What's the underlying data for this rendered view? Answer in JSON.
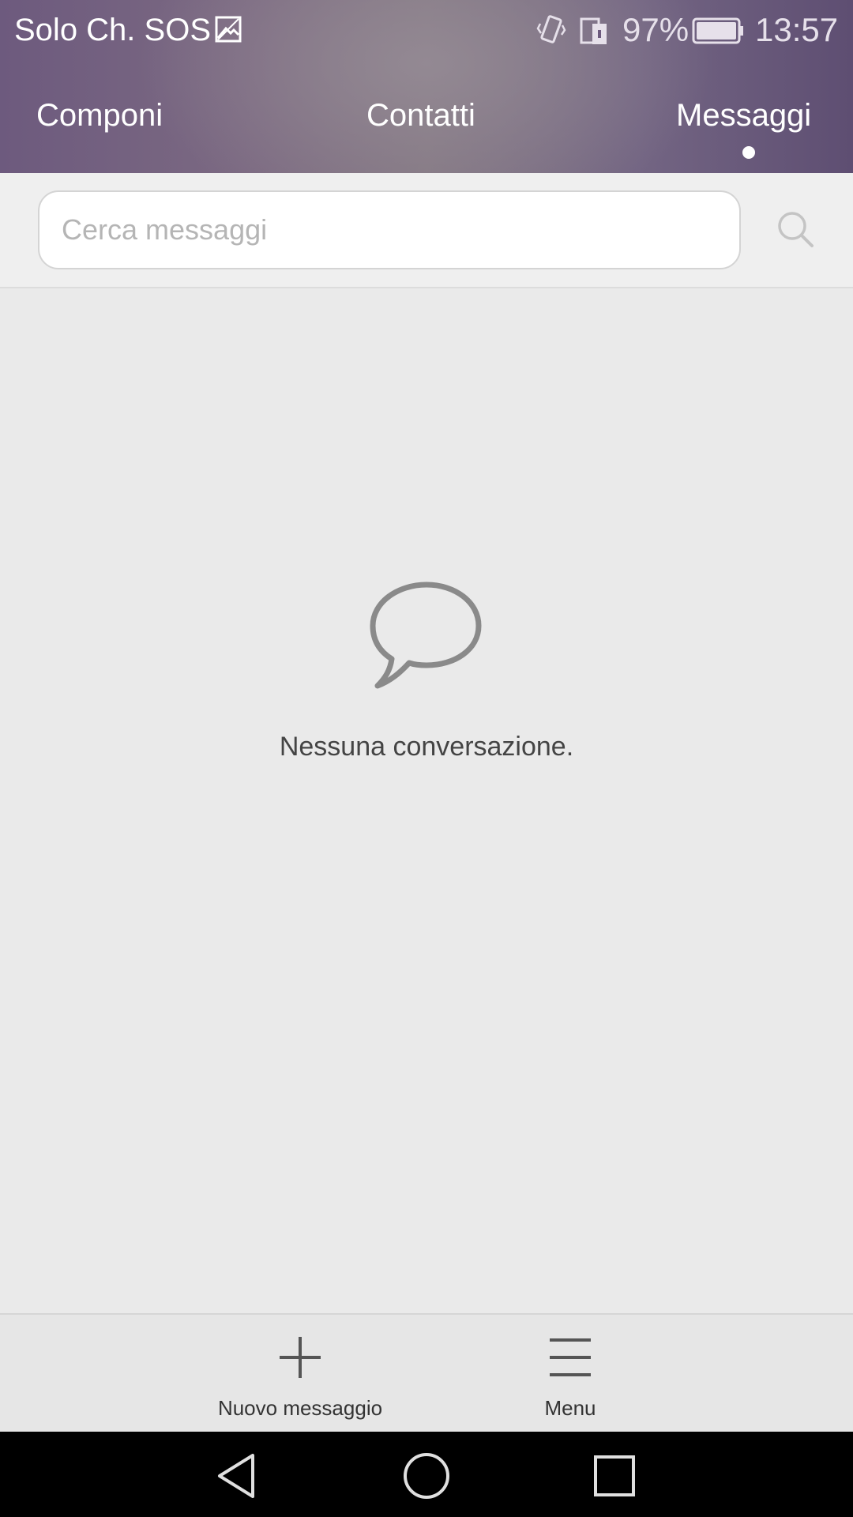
{
  "status_bar": {
    "carrier": "Solo Ch. SOS",
    "battery_percent": "97%",
    "time": "13:57",
    "icons": [
      "image-icon",
      "vibrate-icon",
      "sim-icon",
      "battery-icon"
    ]
  },
  "tabs": [
    {
      "label": "Componi",
      "selected": false
    },
    {
      "label": "Contatti",
      "selected": false
    },
    {
      "label": "Messaggi",
      "selected": true
    }
  ],
  "search": {
    "placeholder": "Cerca messaggi",
    "value": ""
  },
  "empty_state": {
    "icon": "speech-bubble-icon",
    "text": "Nessuna conversazione."
  },
  "bottom_actions": {
    "new_message_label": "Nuovo messaggio",
    "menu_label": "Menu"
  },
  "nav_bar": {
    "icons": [
      "back-icon",
      "home-icon",
      "recents-icon"
    ]
  },
  "colors": {
    "header_accent": "#6d5a7e",
    "background": "#eaeaea",
    "nav_bar": "#000000"
  }
}
